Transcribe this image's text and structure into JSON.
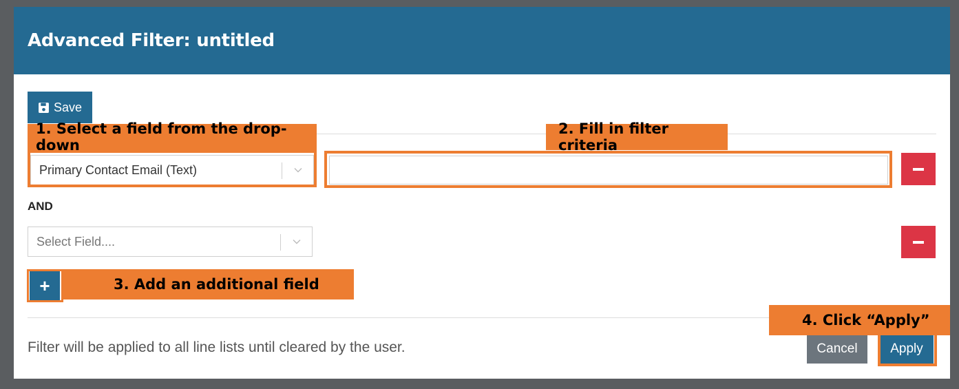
{
  "modal": {
    "title": "Advanced Filter: untitled",
    "save_label": "Save",
    "and_label": "AND",
    "footer_note": "Filter will be applied to all line lists until cleared by the user.",
    "cancel_label": "Cancel",
    "apply_label": "Apply",
    "add_label": "+"
  },
  "filters": [
    {
      "field_value": "Primary Contact Email (Text)",
      "criteria_value": ""
    },
    {
      "field_placeholder": "Select Field...."
    }
  ],
  "callouts": {
    "step1": "1. Select a field from the drop-down",
    "step2": "2. Fill in filter criteria",
    "step3": "3. Add an additional field",
    "step4": "4. Click “Apply”"
  },
  "colors": {
    "header": "#246a92",
    "callout": "#ed7d31",
    "danger": "#dc3545",
    "secondary": "#6c757d"
  }
}
